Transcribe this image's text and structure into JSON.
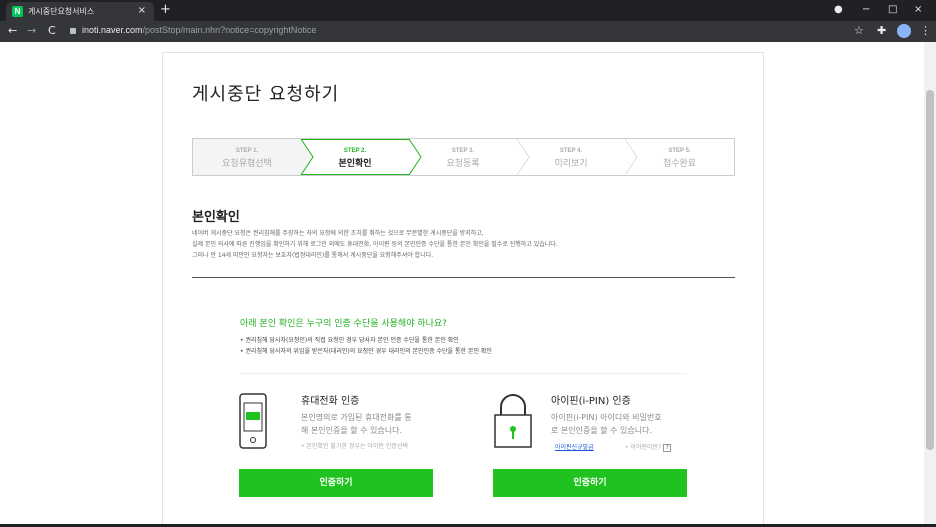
{
  "browser": {
    "tab_title": "게시중단요청서비스",
    "favicon_letter": "N",
    "tab_close": "×",
    "new_tab": "+",
    "url_host": "inoti.naver.com",
    "url_path": "/postStop/main.nhn?notice=copyrightNotice",
    "nav_back": "←",
    "nav_forward": "→",
    "nav_reload": "C",
    "bookmark_star": "☆",
    "menu_dots": "⋮",
    "win_minimize": "−",
    "win_maximize": "□",
    "win_close": "×"
  },
  "page": {
    "title": "게시중단 요청하기",
    "steps": [
      {
        "no": "STEP 1.",
        "label": "요청유형선택",
        "state": "done"
      },
      {
        "no": "STEP 2.",
        "label": "본인확인",
        "state": "active"
      },
      {
        "no": "STEP 3.",
        "label": "요청등록",
        "state": "todo"
      },
      {
        "no": "STEP 4.",
        "label": "미리보기",
        "state": "todo"
      },
      {
        "no": "STEP 5.",
        "label": "접수완료",
        "state": "todo"
      }
    ],
    "section_title": "본인확인",
    "description": [
      "네이버 게시중단 요청은 권리침해를 주장하는 자의 요청에 의한 조치를 취하는 것으로 무분별한 게시중단을 방지하고,",
      "실제 본인 의사에 따른 진행임을 확인하기 위해 로그인 외에도 휴대전화, 아이핀 등의 본인인증 수단을 통한 본인 확인을 필수로 진행하고 있습니다.",
      "그러나 만 14세 미만인 요청자는 보호자(법정대리인)를 통해서 게시중단을 요청해주셔야 합니다."
    ],
    "notice_title": "아래 본인 확인은 누구의 인증 수단을 사용해야 하나요?",
    "notice_items": [
      "권리침해 당사자(요청인)의 직접 요청인 경우 당사자 본인 인증 수단을 통한 본인 확인",
      "권리침해 당사자의 위임을 받은자(대리인)의 요청인 경우 대리인의 본인인증 수단을 통한 본인 확인"
    ],
    "phone": {
      "title": "휴대전화 인증",
      "desc_lines": [
        "본인명의로 가입된 휴대전화를 통",
        "해 본인인증을 할 수 있습니다."
      ],
      "note": "• 본인확인 불가한 경우는 아이핀 인증선택",
      "button": "인증하기",
      "screen_text": "****"
    },
    "ipin": {
      "title": "아이핀(i-PIN) 인증",
      "desc_lines": [
        "아이핀(i-PIN) 아이디와 비밀번호",
        "로 본인인증을 할 수 있습니다."
      ],
      "link": "아이핀신규발급",
      "help": "• 아이핀이란?",
      "help_q": "?",
      "button": "인증하기"
    }
  },
  "colors": {
    "accent": "#1fc21f",
    "accent_text": "#1fb21f",
    "naver": "#03c75a"
  }
}
